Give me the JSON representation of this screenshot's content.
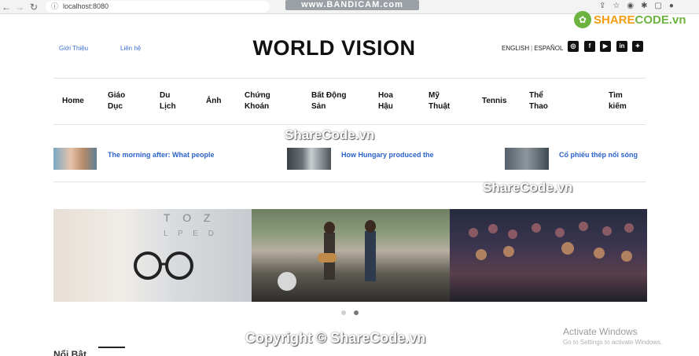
{
  "browser": {
    "url": "localhost:8080",
    "recorder_banner": "www.BANDICAM.com"
  },
  "watermark_logo": {
    "text_a": "SHARE",
    "text_b": "CODE.vn"
  },
  "header": {
    "links": [
      "Giới Thiệu",
      "Liên hệ"
    ],
    "brand": "WORLD VISION",
    "lang_en": "ENGLISH",
    "lang_es": "ESPAÑOL",
    "social": [
      {
        "icon": "instagram-icon",
        "glyph": "◎"
      },
      {
        "icon": "facebook-icon",
        "glyph": "f"
      },
      {
        "icon": "youtube-icon",
        "glyph": "▶"
      },
      {
        "icon": "linkedin-icon",
        "glyph": "in"
      },
      {
        "icon": "twitter-icon",
        "glyph": "✦"
      }
    ]
  },
  "menu": [
    {
      "l1": "Home",
      "l2": ""
    },
    {
      "l1": "Giáo",
      "l2": "Dục"
    },
    {
      "l1": "Du",
      "l2": "Lịch"
    },
    {
      "l1": "Ảnh",
      "l2": ""
    },
    {
      "l1": "Chứng",
      "l2": "Khoán"
    },
    {
      "l1": "Bất Động",
      "l2": "Sản"
    },
    {
      "l1": "Hoa",
      "l2": "Hậu"
    },
    {
      "l1": "Mỹ",
      "l2": "Thuật"
    },
    {
      "l1": "Tennis",
      "l2": ""
    },
    {
      "l1": "Thể",
      "l2": "Thao"
    },
    {
      "l1": "Tìm",
      "l2": "kiếm"
    }
  ],
  "news": [
    {
      "title": "The morning after: What people"
    },
    {
      "title": "How Hungary produced the"
    },
    {
      "title": "Cổ phiếu thép nổi sóng"
    }
  ],
  "watermarks": {
    "a": "ShareCode.vn",
    "b": "ShareCode.vn",
    "c": "Copyright © ShareCode.vn"
  },
  "activate": {
    "title": "Activate Windows",
    "sub": "Go to Settings to activate Windows."
  },
  "section": {
    "title": "Nổi Bật"
  },
  "colors": {
    "link": "#3d6fd1",
    "news_title": "#2c63c8",
    "brand": "#111111"
  }
}
